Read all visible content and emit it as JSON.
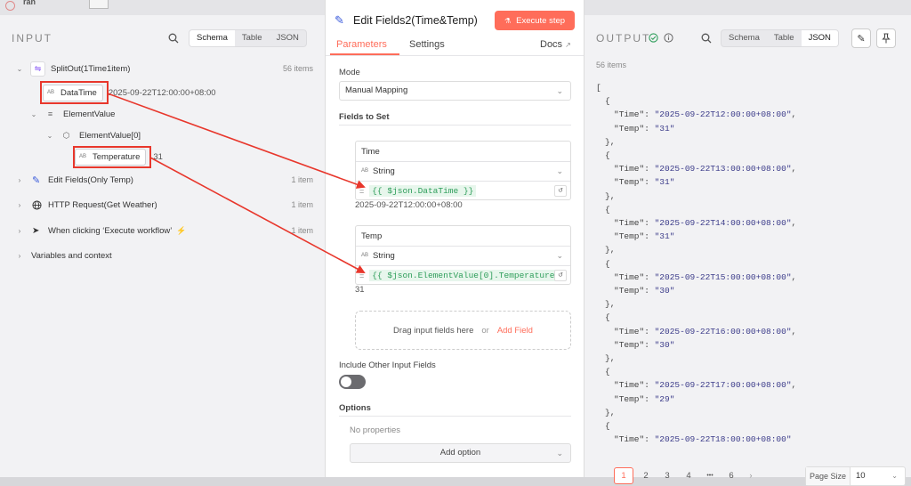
{
  "topbar": {
    "fragment": "ran"
  },
  "input": {
    "title": "INPUT",
    "view_tabs": [
      "Schema",
      "Table",
      "JSON"
    ],
    "tree": {
      "root": {
        "label": "SplitOut(1Time1item)",
        "count": "56 items"
      },
      "datatime": {
        "type": "AB",
        "label": "DataTime",
        "value": "2025-09-22T12:00:00+08:00"
      },
      "element_value": {
        "label": "ElementValue"
      },
      "element_value_0": {
        "label": "ElementValue[0]"
      },
      "temperature": {
        "type": "AB",
        "label": "Temperature",
        "value": "31"
      },
      "nodes": [
        {
          "label": "Edit Fields(Only Temp)",
          "count": "1 item"
        },
        {
          "label": "HTTP Request(Get Weather)",
          "count": "1 item"
        },
        {
          "label": "When clicking ‘Execute workflow’",
          "count": "1 item"
        }
      ],
      "variables": "Variables and context"
    }
  },
  "modal": {
    "title": "Edit Fields2(Time&Temp)",
    "execute_label": "Execute step",
    "tabs": [
      "Parameters",
      "Settings"
    ],
    "docs_label": "Docs",
    "mode_label": "Mode",
    "mode_value": "Manual Mapping",
    "fields_label": "Fields to Set",
    "fields": [
      {
        "name": "Time",
        "type": "String",
        "expression": "{{ $json.DataTime }}",
        "result": "2025-09-22T12:00:00+08:00"
      },
      {
        "name": "Temp",
        "type": "String",
        "expression": "{{ $json.ElementValue[0].Temperature",
        "result": "31"
      }
    ],
    "type_badge": "AB",
    "drop_text": "Drag input fields here",
    "drop_or": "or",
    "add_field": "Add Field",
    "include_label": "Include Other Input Fields",
    "options_label": "Options",
    "no_properties": "No properties",
    "add_option": "Add option"
  },
  "output": {
    "title": "OUTPUT",
    "count": "56 items",
    "view_tabs": [
      "Schema",
      "Table",
      "JSON"
    ],
    "json_open": "[",
    "records": [
      {
        "time": "2025-09-22T12:00:00+08:00",
        "temp": "31"
      },
      {
        "time": "2025-09-22T13:00:00+08:00",
        "temp": "31"
      },
      {
        "time": "2025-09-22T14:00:00+08:00",
        "temp": "31"
      },
      {
        "time": "2025-09-22T15:00:00+08:00",
        "temp": "30"
      },
      {
        "time": "2025-09-22T16:00:00+08:00",
        "temp": "30"
      },
      {
        "time": "2025-09-22T17:00:00+08:00",
        "temp": "29"
      },
      {
        "time": "2025-09-22T18:00:00+08:00"
      }
    ],
    "pagination": {
      "pages": [
        "1",
        "2",
        "3",
        "4",
        "•••",
        "6"
      ],
      "current": "1",
      "page_size_label": "Page Size",
      "page_size_value": "10"
    }
  },
  "colors": {
    "accent": "#ff6d5a",
    "execute_bg": "#ff6d5a",
    "annotation": "#e8372c",
    "expr_bg": "#e7f6ec",
    "expr_text": "#2f9e5b",
    "success": "#2f9e5b"
  }
}
